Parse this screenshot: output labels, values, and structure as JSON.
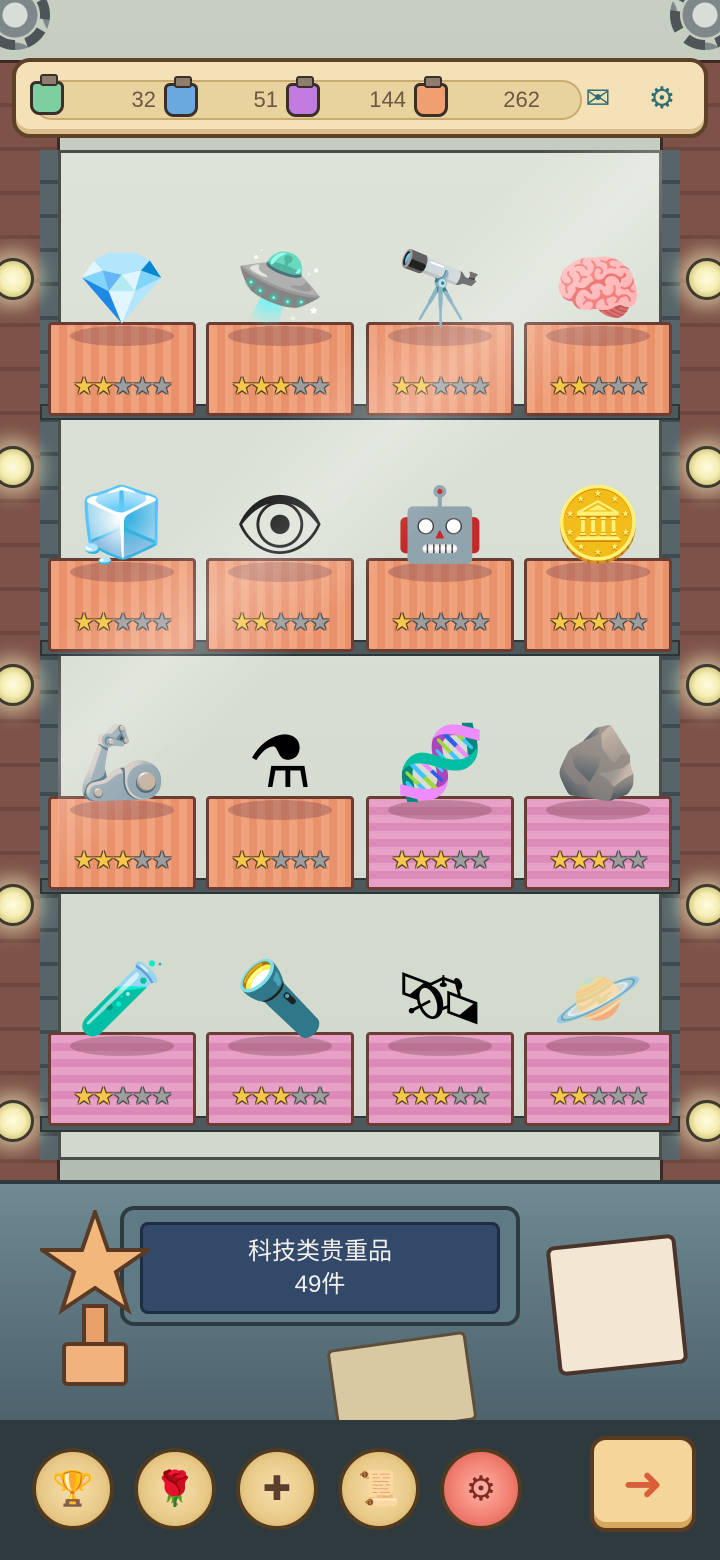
{
  "resources": [
    {
      "icon": "green-potion-jar-icon",
      "value": "32",
      "color": "#7ecf9f"
    },
    {
      "icon": "blue-potion-jar-icon",
      "value": "51",
      "color": "#6aa8e0"
    },
    {
      "icon": "purple-potion-jar-icon",
      "value": "144",
      "color": "#c07ae0"
    },
    {
      "icon": "orange-potion-jar-icon",
      "value": "262",
      "color": "#f0a070"
    }
  ],
  "top_buttons": [
    {
      "icon": "mail-icon",
      "glyph": "✉"
    },
    {
      "icon": "gear-icon",
      "glyph": "⚙"
    }
  ],
  "shelves": [
    [
      {
        "icon": "green-crystal-icon",
        "glyph": "💎",
        "stars": 2,
        "cloth": "orange"
      },
      {
        "icon": "teleporter-device-icon",
        "glyph": "🛸",
        "stars": 3,
        "cloth": "orange"
      },
      {
        "icon": "space-telescope-icon",
        "glyph": "🔭",
        "stars": 2,
        "cloth": "orange"
      },
      {
        "icon": "brain-icon",
        "glyph": "🧠",
        "stars": 2,
        "cloth": "orange"
      }
    ],
    [
      {
        "icon": "color-cube-icon",
        "glyph": "🧊",
        "stars": 2,
        "cloth": "orange"
      },
      {
        "icon": "robot-eye-orb-icon",
        "glyph": "👁",
        "stars": 2,
        "cloth": "orange"
      },
      {
        "icon": "robot-icon",
        "glyph": "🤖",
        "stars": 1,
        "cloth": "orange"
      },
      {
        "icon": "gold-ore-icon",
        "glyph": "🪙",
        "stars": 3,
        "cloth": "orange"
      }
    ],
    [
      {
        "icon": "mech-robot-icon",
        "glyph": "🦾",
        "stars": 3,
        "cloth": "orange"
      },
      {
        "icon": "machine-tank-icon",
        "glyph": "⚗",
        "stars": 2,
        "cloth": "orange"
      },
      {
        "icon": "dna-document-icon",
        "glyph": "🧬",
        "stars": 3,
        "cloth": "pink"
      },
      {
        "icon": "grey-rock-icon",
        "glyph": "🪨",
        "stars": 3,
        "cloth": "pink"
      }
    ],
    [
      {
        "icon": "test-tube-icon",
        "glyph": "🧪",
        "stars": 2,
        "cloth": "pink"
      },
      {
        "icon": "cannon-icon",
        "glyph": "🔦",
        "stars": 3,
        "cloth": "pink"
      },
      {
        "icon": "satellite-icon",
        "glyph": "🛰",
        "stars": 3,
        "cloth": "pink"
      },
      {
        "icon": "planet-model-icon",
        "glyph": "🪐",
        "stars": 2,
        "cloth": "pink"
      }
    ]
  ],
  "plaque": {
    "title": "科技类贵重品",
    "count": "49件"
  },
  "nav": [
    {
      "icon": "trophy-cup-icon",
      "glyph": "🏆"
    },
    {
      "icon": "rose-icon",
      "glyph": "🌹"
    },
    {
      "icon": "puzzle-cross-icon",
      "glyph": "✚"
    },
    {
      "icon": "scroll-icon",
      "glyph": "📜"
    },
    {
      "icon": "tech-gear-icon",
      "glyph": "⚙",
      "active": true
    }
  ],
  "next_button": {
    "icon": "arrow-right-icon",
    "glyph": "➜"
  }
}
